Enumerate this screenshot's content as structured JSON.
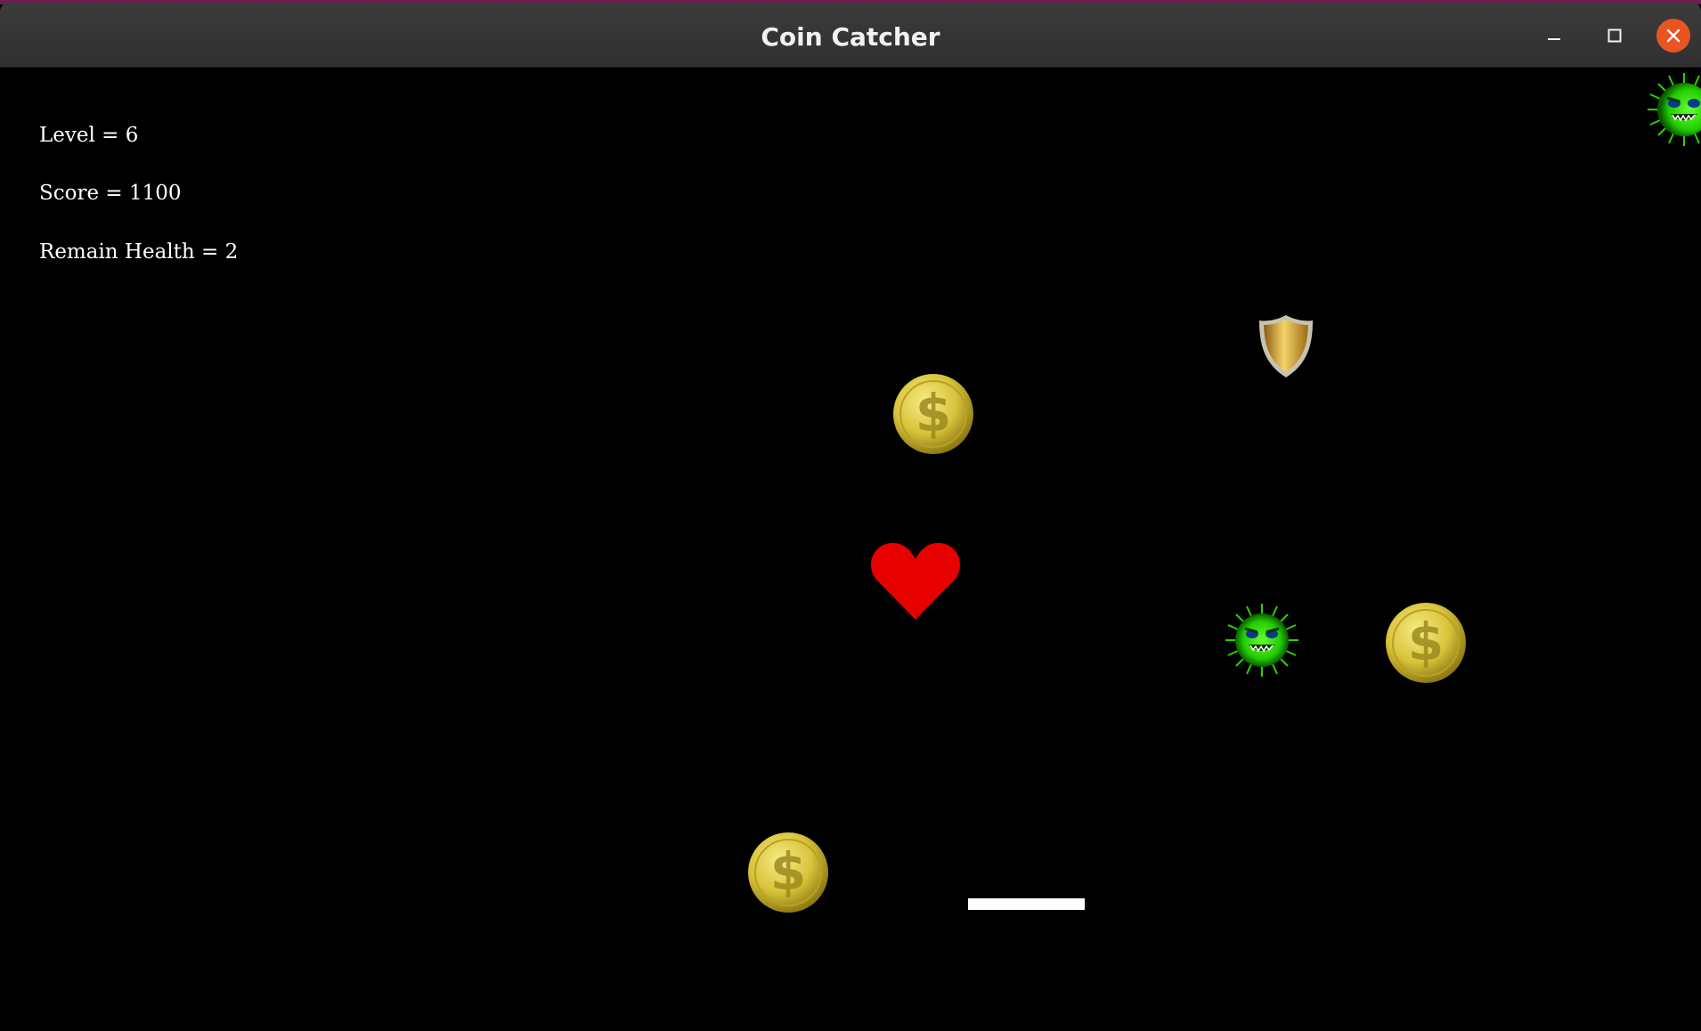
{
  "window": {
    "title": "Coin Catcher",
    "buttons": {
      "minimize_icon": "minimize-icon",
      "maximize_icon": "maximize-icon",
      "close_icon": "close-icon"
    },
    "close_color": "#e95420"
  },
  "hud": {
    "level_text": "Level = 6",
    "score_text": "Score = 1100",
    "health_text": "Remain Health = 2"
  },
  "sprites": {
    "coin_icon": "dollar-coin-icon",
    "heart_icon": "heart-icon",
    "shield_icon": "shield-icon",
    "monster_icon": "green-monster-icon",
    "paddle": "white-paddle"
  },
  "colors": {
    "background": "#000000",
    "coin": "#d9c33a",
    "heart": "#e60000",
    "monster": "#33dd00",
    "shield": "#d8a82a",
    "paddle": "#ffffff"
  }
}
